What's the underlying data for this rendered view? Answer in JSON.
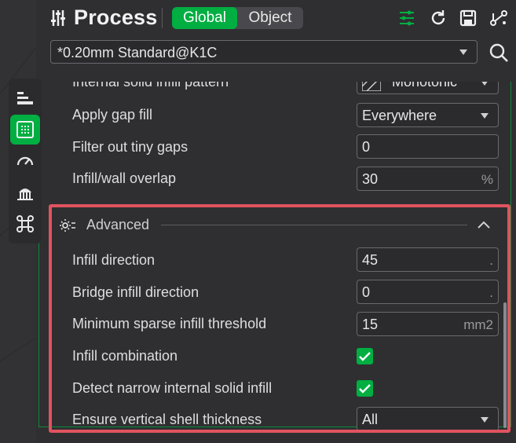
{
  "header": {
    "title": "Process",
    "toggle": {
      "global_label": "Global",
      "object_label": "Object",
      "selected": "Global"
    },
    "icons": [
      "settings-sliders-icon",
      "reset-icon",
      "save-icon",
      "compare-icon"
    ]
  },
  "preset": {
    "value": "*0.20mm Standard@K1C",
    "search_icon": "search-icon"
  },
  "tabs": [
    {
      "name": "quality-tab",
      "icon": "layers-icon",
      "active": false
    },
    {
      "name": "strength-tab",
      "icon": "infill-grid-icon",
      "active": true
    },
    {
      "name": "speed-tab",
      "icon": "speedometer-icon",
      "active": false
    },
    {
      "name": "support-tab",
      "icon": "support-icon",
      "active": false
    },
    {
      "name": "others-tab",
      "icon": "command-icon",
      "active": false
    }
  ],
  "settings": {
    "partial_top": {
      "label": "Internal solid infill pattern",
      "value": "Monotonic"
    },
    "rows": [
      {
        "label": "Apply gap fill",
        "value": "Everywhere",
        "type": "select"
      },
      {
        "label": "Filter out tiny gaps",
        "value": "0",
        "type": "input",
        "unit": ""
      },
      {
        "label": "Infill/wall overlap",
        "value": "30",
        "type": "input",
        "unit": "%"
      }
    ]
  },
  "advanced": {
    "title": "Advanced",
    "rows": [
      {
        "label": "Infill direction",
        "value": "45",
        "type": "input",
        "unit": "."
      },
      {
        "label": "Bridge infill direction",
        "value": "0",
        "type": "input",
        "unit": "."
      },
      {
        "label": "Minimum sparse infill threshold",
        "value": "15",
        "type": "input",
        "unit": "mm2"
      },
      {
        "label": "Infill combination",
        "checked": true,
        "type": "checkbox"
      },
      {
        "label": "Detect narrow internal solid infill",
        "checked": true,
        "type": "checkbox"
      },
      {
        "label": "Ensure vertical shell thickness",
        "value": "All",
        "type": "select"
      }
    ]
  },
  "colors": {
    "accent": "#00ae42",
    "highlight": "#e0535f",
    "panel_bg": "#2f2f31"
  }
}
